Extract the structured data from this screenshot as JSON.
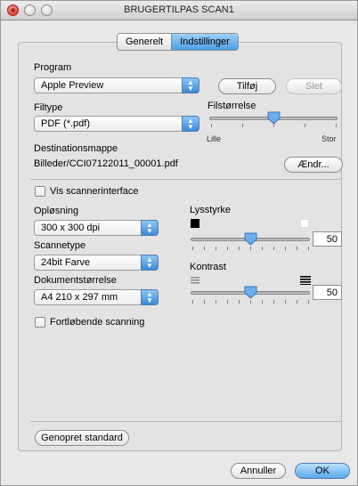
{
  "window": {
    "title": "BRUGERTILPAS SCAN1"
  },
  "tabs": [
    {
      "label": "Generelt"
    },
    {
      "label": "Indstillinger"
    }
  ],
  "program": {
    "label": "Program",
    "selected": "Apple Preview",
    "add_button": "Tilføj",
    "delete_button": "Slet"
  },
  "filetype": {
    "label": "Filtype",
    "selected": "PDF (*.pdf)"
  },
  "filesize": {
    "label": "Filstørrelse",
    "min_label": "Lille",
    "max_label": "Stor",
    "level": 0.5
  },
  "destination": {
    "label": "Destinationsmappe",
    "path": "Billeder/CCI07122011_00001.pdf",
    "change_button": "Ændr..."
  },
  "show_scanner_interface": {
    "label": "Vis scannerinterface",
    "checked": false
  },
  "resolution": {
    "label": "Opløsning",
    "selected": "300 x 300 dpi"
  },
  "scan_type": {
    "label": "Scannetype",
    "selected": "24bit Farve"
  },
  "document_size": {
    "label": "Dokumentstørrelse",
    "selected": "A4 210 x 297 mm"
  },
  "continuous_scan": {
    "label": "Fortløbende scanning",
    "checked": false
  },
  "brightness": {
    "label": "Lysstyrke",
    "value": "50",
    "level": 0.5
  },
  "contrast": {
    "label": "Kontrast",
    "value": "50",
    "level": 0.5
  },
  "footer": {
    "restore_button": "Genopret standard",
    "cancel_button": "Annuller",
    "ok_button": "OK"
  },
  "colors": {
    "accent": "#4c9de3",
    "close": "#d5261a"
  },
  "icons": {
    "popup_arrow": "updown-arrows-icon",
    "close": "close-icon"
  }
}
